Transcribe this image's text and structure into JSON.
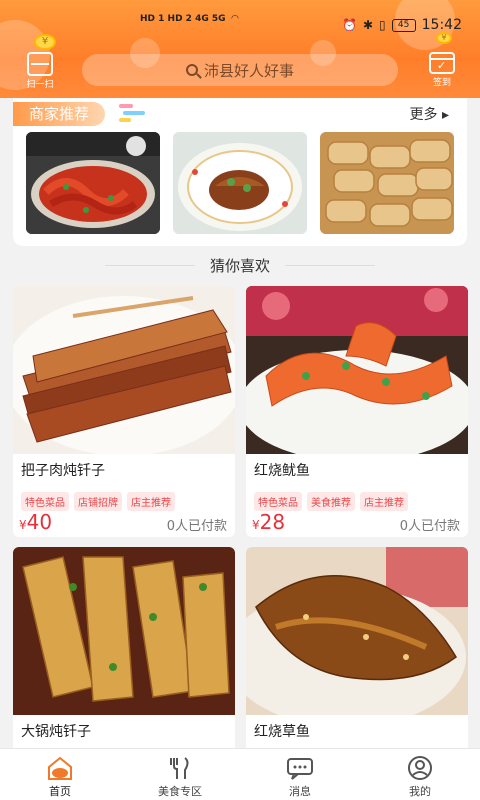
{
  "status_bar": {
    "network": "HD 1 HD 2 4G 5G",
    "battery": "45",
    "time": "15:42"
  },
  "header": {
    "scan_label": "扫一扫",
    "search_placeholder": "沛县好人好事",
    "checkin_label": "签到"
  },
  "merchant": {
    "title": "商家推荐",
    "more_label": "更多 ▸",
    "thumbnails": [
      "crayfish-dish",
      "braised-dish",
      "tofu-skin-rolls"
    ]
  },
  "guess_title": "猜你喜欢",
  "products": [
    {
      "name": "把子肉炖钎子",
      "tags": [
        "特色菜品",
        "店铺招牌",
        "店主推荐"
      ],
      "currency": "¥",
      "price": "40",
      "paid": "0人已付款"
    },
    {
      "name": "红烧鱿鱼",
      "tags": [
        "特色菜品",
        "美食推荐",
        "店主推荐"
      ],
      "currency": "¥",
      "price": "28",
      "paid": "0人已付款"
    },
    {
      "name": "大锅炖钎子",
      "tags": [],
      "currency": "",
      "price": "",
      "paid": ""
    },
    {
      "name": "红烧草鱼",
      "tags": [],
      "currency": "",
      "price": "",
      "paid": ""
    }
  ],
  "nav": [
    {
      "label": "首页",
      "icon": "home-icon",
      "active": true
    },
    {
      "label": "美食专区",
      "icon": "cutlery-icon",
      "active": false
    },
    {
      "label": "消息",
      "icon": "message-icon",
      "active": false
    },
    {
      "label": "我的",
      "icon": "profile-icon",
      "active": false
    }
  ],
  "colors": {
    "accent": "#ff7e2a",
    "price": "#e8303a",
    "tag": "#e8474a"
  }
}
